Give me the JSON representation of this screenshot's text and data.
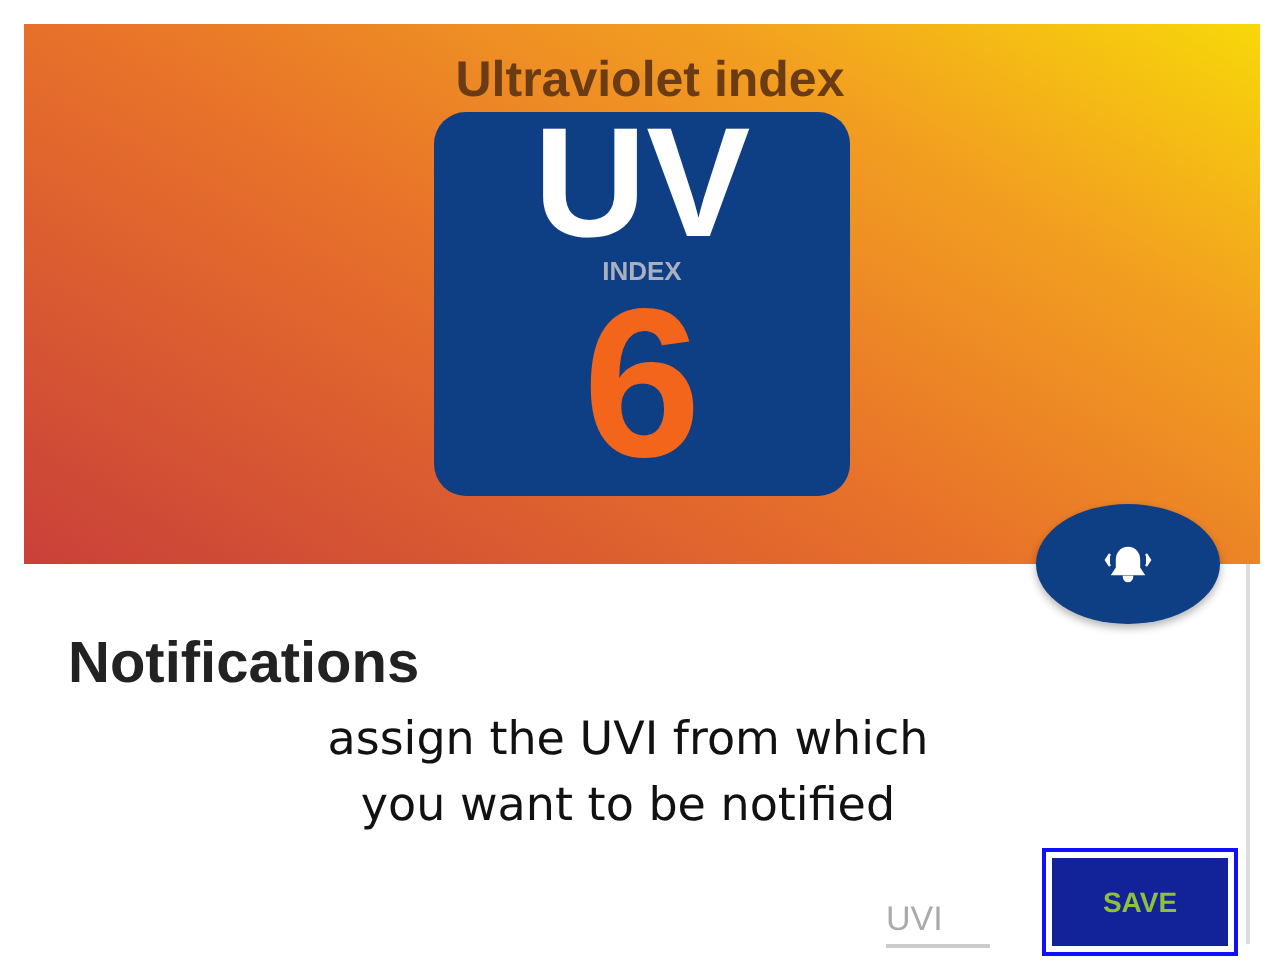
{
  "header": {
    "title": "Ultraviolet index",
    "badge": {
      "top": "UV",
      "middle": "INDEX",
      "value": "6"
    }
  },
  "card": {
    "title": "Notifications",
    "description": "assign the UVI from which\nyou want to be notified",
    "input": {
      "placeholder": "UVI"
    },
    "buttons": [
      {
        "label": "SAVE",
        "focused": true
      }
    ]
  }
}
